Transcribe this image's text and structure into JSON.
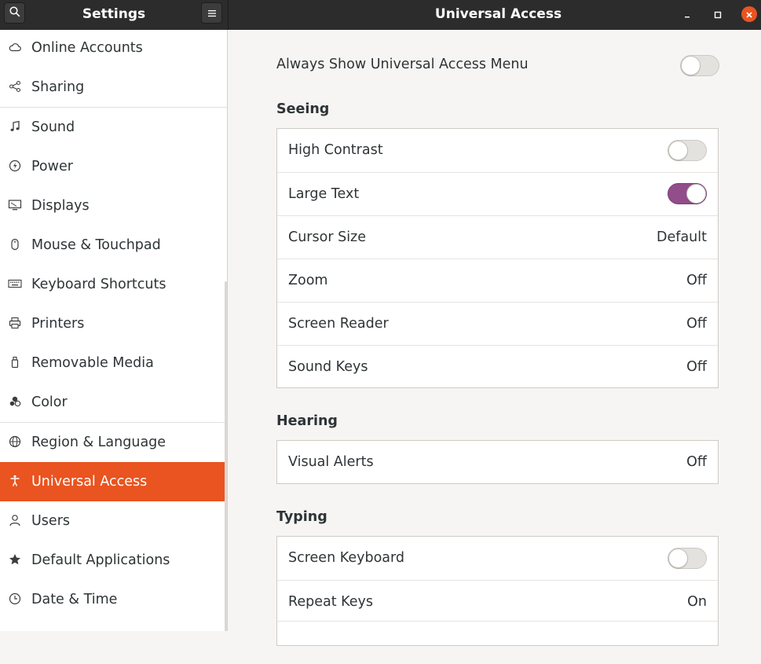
{
  "header": {
    "sidebar_title": "Settings",
    "main_title": "Universal Access",
    "search_icon": "search-icon",
    "menu_icon": "hamburger-menu-icon",
    "window_controls": [
      "minimize-icon",
      "maximize-icon",
      "close-icon"
    ]
  },
  "sidebar": {
    "items": [
      {
        "label": "Online Accounts",
        "icon": "cloud-icon"
      },
      {
        "label": "Sharing",
        "icon": "share-icon"
      },
      {
        "label": "Sound",
        "icon": "music-note-icon"
      },
      {
        "label": "Power",
        "icon": "power-icon"
      },
      {
        "label": "Displays",
        "icon": "display-icon"
      },
      {
        "label": "Mouse & Touchpad",
        "icon": "mouse-icon"
      },
      {
        "label": "Keyboard Shortcuts",
        "icon": "keyboard-icon"
      },
      {
        "label": "Printers",
        "icon": "printer-icon"
      },
      {
        "label": "Removable Media",
        "icon": "usb-drive-icon"
      },
      {
        "label": "Color",
        "icon": "color-circles-icon"
      },
      {
        "label": "Region & Language",
        "icon": "globe-icon"
      },
      {
        "label": "Universal Access",
        "icon": "accessibility-icon",
        "active": true
      },
      {
        "label": "Users",
        "icon": "user-icon"
      },
      {
        "label": "Default Applications",
        "icon": "star-icon"
      },
      {
        "label": "Date & Time",
        "icon": "clock-icon"
      }
    ]
  },
  "main": {
    "always_show_label": "Always Show Universal Access Menu",
    "always_show_on": false,
    "seeing": {
      "heading": "Seeing",
      "rows": [
        {
          "label": "High Contrast",
          "toggle": false
        },
        {
          "label": "Large Text",
          "toggle": true
        },
        {
          "label": "Cursor Size",
          "value": "Default"
        },
        {
          "label": "Zoom",
          "value": "Off"
        },
        {
          "label": "Screen Reader",
          "value": "Off"
        },
        {
          "label": "Sound Keys",
          "value": "Off"
        }
      ]
    },
    "hearing": {
      "heading": "Hearing",
      "rows": [
        {
          "label": "Visual Alerts",
          "value": "Off"
        }
      ]
    },
    "typing": {
      "heading": "Typing",
      "rows": [
        {
          "label": "Screen Keyboard",
          "toggle": false
        },
        {
          "label": "Repeat Keys",
          "value": "On"
        }
      ]
    }
  },
  "colors": {
    "accent": "#e95420",
    "toggle_on": "#924d8b",
    "headerbar": "#2c2c2c"
  }
}
